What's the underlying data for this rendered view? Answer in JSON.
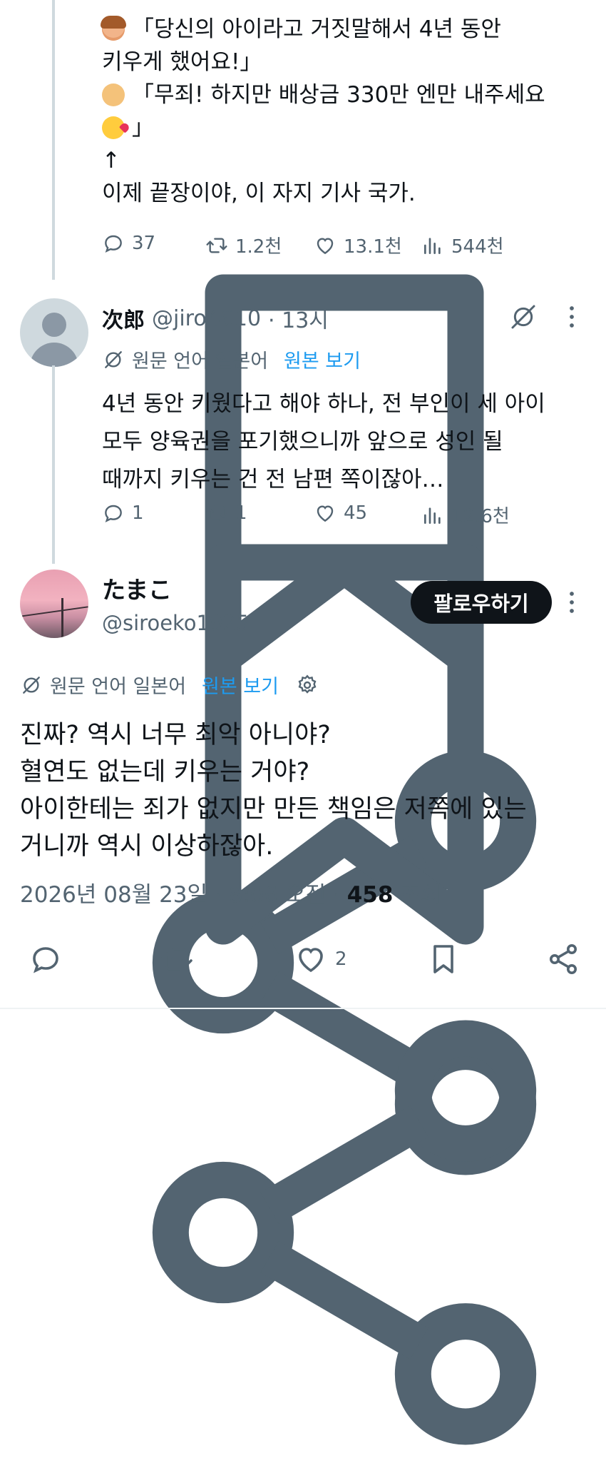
{
  "tweet1": {
    "lines": [
      "「당신의 아이라고 거짓말해서 4년 동안",
      "키우게 했어요!」",
      "「무죄! 하지만 배상금 330만 엔만 내주세요",
      "」",
      "↑",
      "이제 끝장이야, 이 자지 기사 국가."
    ],
    "stats": {
      "replies": "37",
      "retweets": "1.2천",
      "likes": "13.1천",
      "views": "544천"
    }
  },
  "reply": {
    "name": "次郎",
    "handle": "@jiro4610",
    "time": "· 13시",
    "translation": {
      "label": "원문 언어 일본어",
      "link": "원본 보기"
    },
    "lines": [
      "4년 동안 키웠다고 해야 하나, 전 부인이 세 아이",
      "모두 양육권을 포기했으니까 앞으로 성인 될",
      "때까지 키우는 건 전 남편 쪽이잖아…"
    ],
    "stats": {
      "replies": "1",
      "retweets": "1",
      "likes": "45",
      "views": "12.6천"
    }
  },
  "main": {
    "name": "たまこ",
    "handle": "@siroeko1925",
    "follow_label": "팔로우하기",
    "translation": {
      "label": "원문 언어 일본어",
      "link": "원본 보기"
    },
    "lines": [
      "진짜? 역시 너무 최악 아니야?",
      "혈연도 없는데 키우는 거야?",
      "아이한테는 죄가 없지만 만든 책임은 저쪽에 있는",
      "거니까 역시 이상하잖아."
    ],
    "date": "2026년 08월 23일 · 8:06 오전 ·",
    "views": "458",
    "views_label": "조회",
    "likes": "2"
  },
  "colors": {
    "muted": "#536471",
    "link": "#1d9bf0",
    "text": "#0f1419",
    "button": "#0f1419"
  }
}
